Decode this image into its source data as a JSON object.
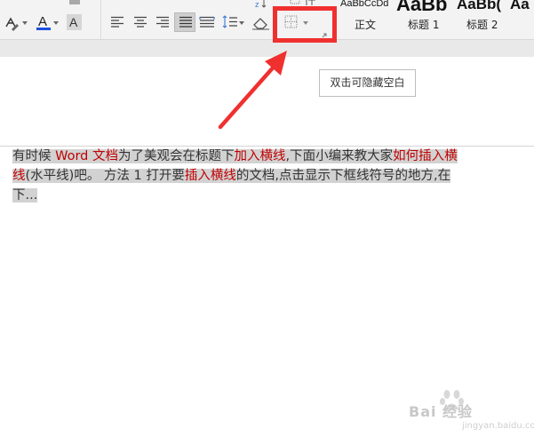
{
  "ribbon": {
    "styles": [
      {
        "preview": "AaBbCcDd",
        "name": "正文"
      },
      {
        "preview": "AaBb",
        "name": "标题 1"
      },
      {
        "preview": "AaBb(",
        "name": "标题 2"
      },
      {
        "preview": "Aa",
        "name": ""
      }
    ]
  },
  "tooltip": {
    "text": "双击可隐藏空白"
  },
  "document": {
    "line1": [
      {
        "t": "有时候 ",
        "c": "n"
      },
      {
        "t": "Word 文档",
        "c": "r"
      },
      {
        "t": "为了美观会在标题下",
        "c": "n"
      },
      {
        "t": "加入横线",
        "c": "r"
      },
      {
        "t": ",下面小编来教大家",
        "c": "n"
      },
      {
        "t": "如何插入横",
        "c": "r"
      }
    ],
    "line2": [
      {
        "t": "线",
        "c": "r"
      },
      {
        "t": "(水平线)吧。  方法  1  打开要",
        "c": "n"
      },
      {
        "t": "插入横线",
        "c": "r"
      },
      {
        "t": "的文档,点击显示下框线符号的地方,在",
        "c": "n"
      }
    ],
    "line3": [
      {
        "t": "下...",
        "c": "n"
      }
    ]
  },
  "watermark": {
    "main": "Bai 经验",
    "sub": "jingyan.baidu.com"
  },
  "colors": {
    "highlight_box": "#f0302f",
    "arrow": "#f0302f",
    "link_red": "#c00000",
    "selection": "#d2d2d2"
  }
}
